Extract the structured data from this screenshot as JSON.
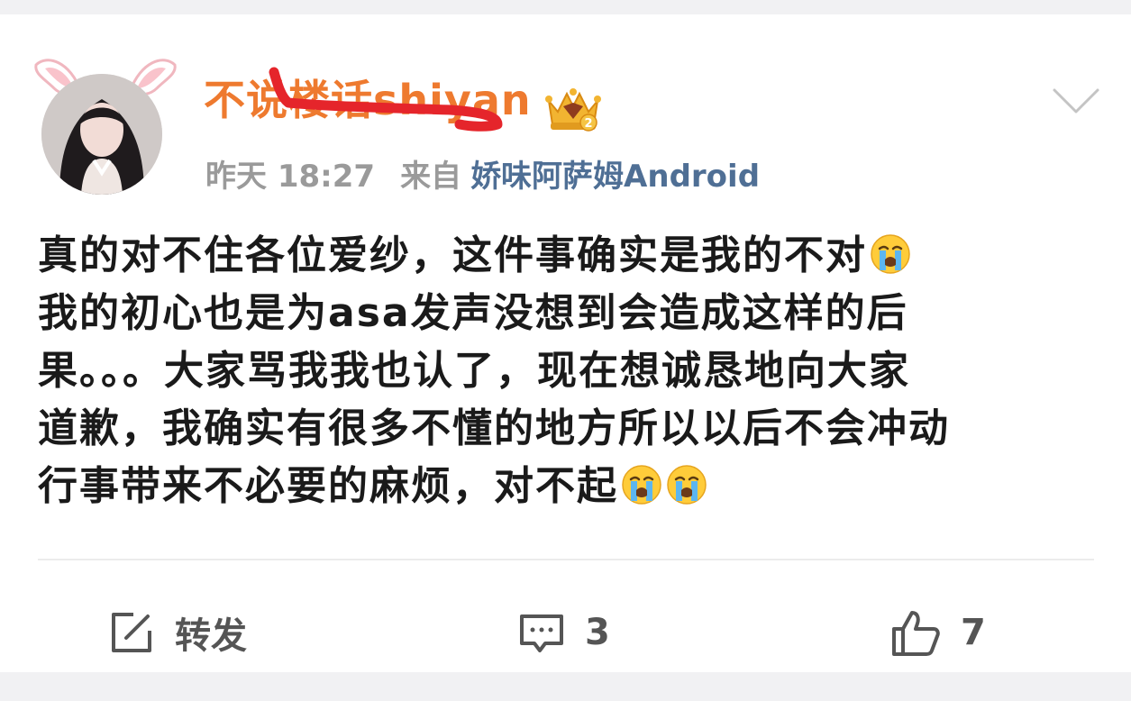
{
  "post": {
    "author": {
      "name": "不说楼话shiyan",
      "vip_level": "2"
    },
    "time": "昨天 18:27",
    "source_label": "来自",
    "source_app": "娇味阿萨姆Android",
    "body_lines": [
      "真的对不住各位爱纱，这件事确实是我的不对",
      "我的初心也是为asa发声没想到会造成这样的后",
      "果。。。大家骂我我也认了，现在想诚恳地向大家",
      "道歉，我确实有很多不懂的地方所以以后不会冲动",
      "行事带来不必要的麻烦，对不起"
    ],
    "emoji_names": [
      "loudly-crying-face-icon",
      "loudly-crying-face-icon",
      "loudly-crying-face-icon"
    ]
  },
  "actions": {
    "repost_label": "转发",
    "comment_count": "3",
    "like_count": "7"
  },
  "colors": {
    "username": "#ee7a2f",
    "source_link": "#4f6f95",
    "meta": "#9a9a9a",
    "scribble": "#e5252b",
    "background": "#f1f1f3"
  }
}
